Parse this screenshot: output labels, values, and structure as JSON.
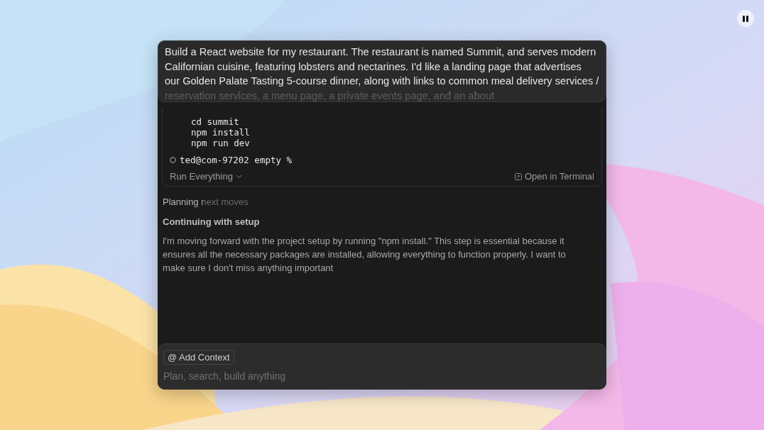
{
  "prompt": {
    "text": "Build a React website for my restaurant. The restaurant is named Summit, and serves modern Californian cuisine, featuring lobsters and nectarines. I'd like a landing page that advertises our Golden Palate Tasting 5-course dinner, along with links to common meal delivery services / reservation services, a menu page, a private events page, and an about"
  },
  "terminal": {
    "lines": [
      "cd summit",
      "npm install",
      "npm run dev"
    ],
    "prompt_line": "ted@com-97202 empty %",
    "run_button": "Run Everything",
    "open_button": "Open in Terminal"
  },
  "status": "Planning next moves",
  "thought": {
    "title": "Continuing with setup",
    "text": "I'm moving forward with the project setup by running \"npm install.\" This step is essential because it ensures all the necessary packages are installed, allowing everything to function properly. I want to make sure I don't miss anything important"
  },
  "composer": {
    "context_button": "@ Add Context",
    "placeholder": "Plan, search, build anything"
  }
}
